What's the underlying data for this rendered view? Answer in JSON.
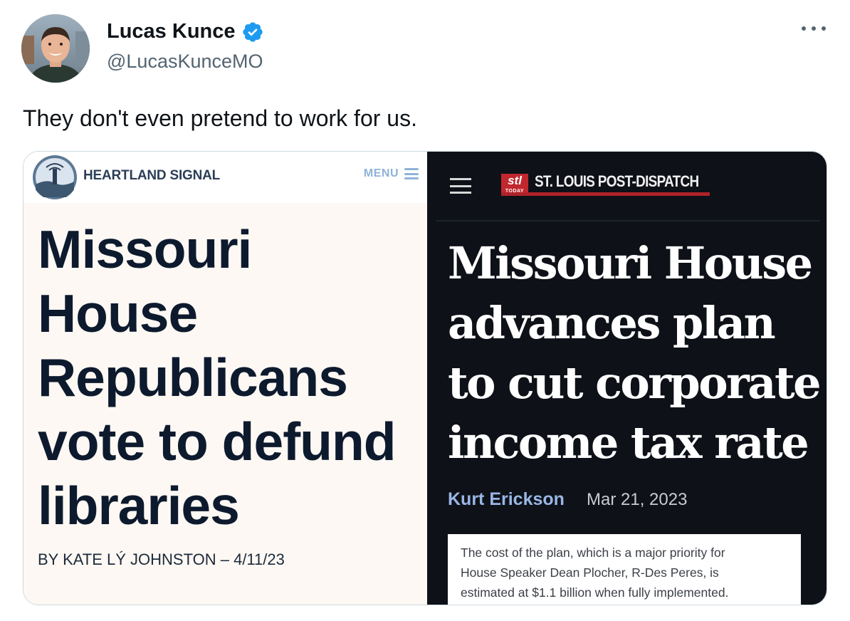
{
  "tweet": {
    "author_name": "Lucas Kunce",
    "author_handle": "@LucasKunceMO",
    "text": "They don't even pretend to work for us."
  },
  "icons": {
    "verified": "verified-badge-icon",
    "more": "more-options-icon"
  },
  "colors": {
    "verified_blue": "#1d9bf0",
    "handle_gray": "#536471",
    "postdispatch_red": "#c1272d",
    "heartland_navy": "#0d1a2e"
  },
  "media": {
    "left": {
      "brand": "HEARTLAND SIGNAL",
      "logo_text": "HEARTLAND SIGNAL",
      "menu_label": "MENU",
      "headline": [
        "Missouri",
        "House",
        "Republicans",
        "vote to defund",
        "libraries"
      ],
      "byline": "BY KATE LÝ JOHNSTON – 4/11/23"
    },
    "right": {
      "logo_mark": "stl",
      "logo_sub": "TODAY",
      "brand": "ST. LOUIS POST-DISPATCH",
      "headline": [
        "Missouri House",
        "advances plan",
        "to cut corporate",
        "income tax rate"
      ],
      "author": "Kurt Erickson",
      "date": "Mar 21, 2023",
      "quote": [
        "The cost of the plan, which is a major priority for",
        "House Speaker Dean Plocher, R-Des Peres, is",
        "estimated at $1.1 billion when fully implemented."
      ]
    }
  }
}
